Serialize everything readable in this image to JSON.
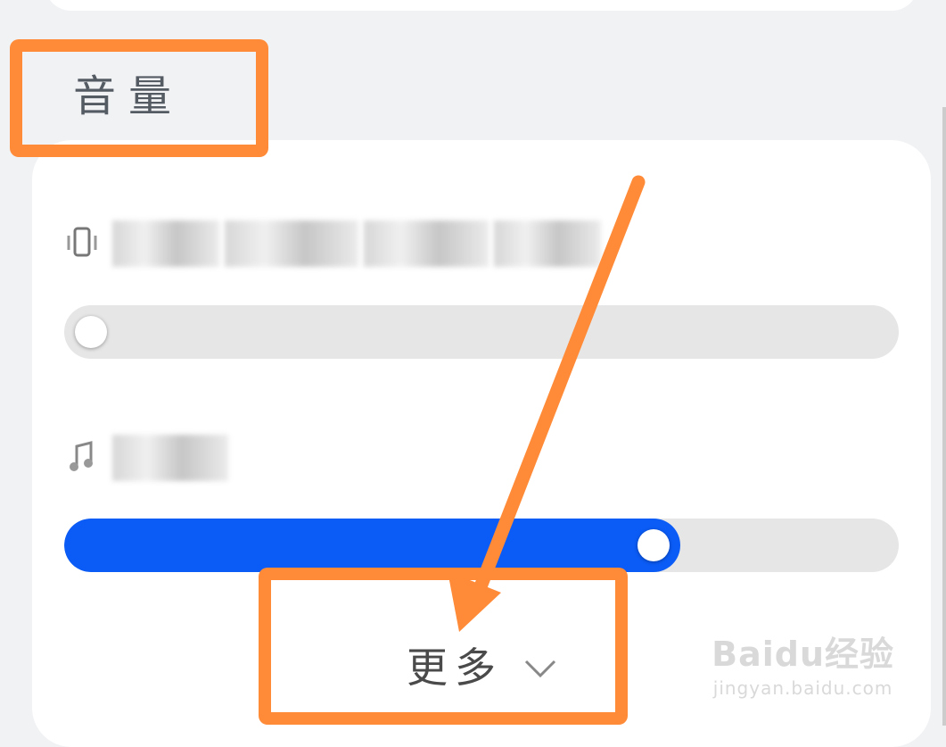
{
  "section": {
    "title": "音量"
  },
  "sliders": [
    {
      "id": "ringtone-volume",
      "value_fraction": 0.0,
      "accent": "#0b5cf7"
    },
    {
      "id": "media-volume",
      "value_fraction": 0.72,
      "accent": "#0b5cf7"
    }
  ],
  "more": {
    "label": "更多",
    "icon": "chevron-down-icon"
  },
  "annotation": {
    "color": "#ff8b38"
  },
  "watermark": {
    "brand": "Baidu经验",
    "url": "jingyan.baidu.com"
  }
}
